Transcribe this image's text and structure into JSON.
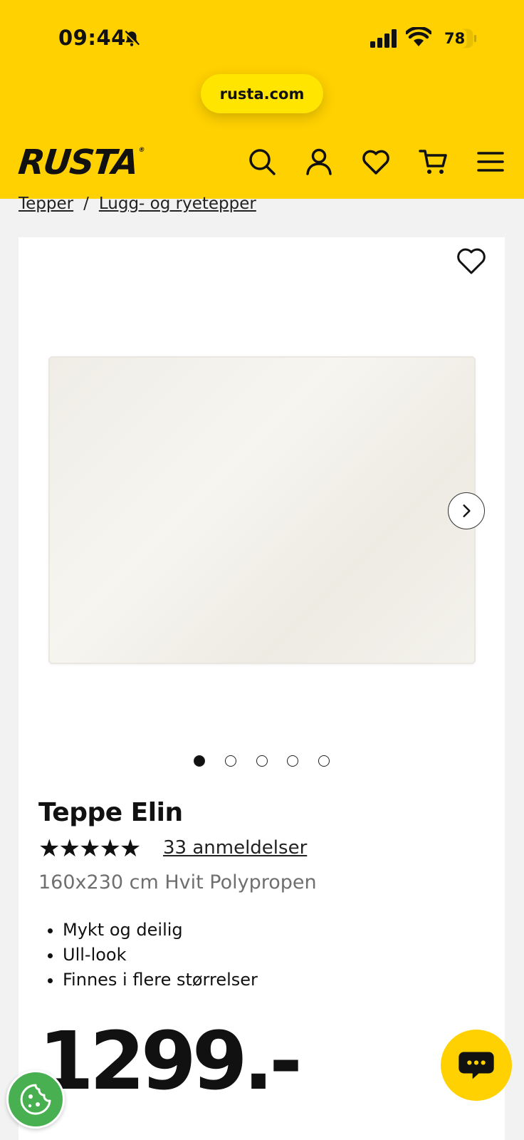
{
  "status_bar": {
    "time": "09:44",
    "battery": "78",
    "icons": [
      "bell-muted-icon",
      "signal-icon",
      "wifi-icon",
      "battery-icon"
    ]
  },
  "browser": {
    "url": "rusta.com"
  },
  "header": {
    "logo": "RUSTA",
    "logo_mark": "®",
    "brand_color": "#ffd100",
    "nav_icons": [
      "search-icon",
      "account-icon",
      "wishlist-icon",
      "cart-icon",
      "menu-icon"
    ]
  },
  "breadcrumb": {
    "items": [
      "Tepper",
      "Lugg- og ryetepper"
    ],
    "separator": "/"
  },
  "product": {
    "title": "Teppe Elin",
    "stars": "★★★★★",
    "rating": 5,
    "reviews_label": "33 anmeldelser",
    "subtitle": "160x230 cm Hvit Polypropen",
    "features": [
      "Mykt og deilig",
      "Ull-look",
      "Finnes i flere størrelser"
    ],
    "price": "1299.-",
    "gallery": {
      "image_count": 5,
      "active_index": 0
    }
  }
}
